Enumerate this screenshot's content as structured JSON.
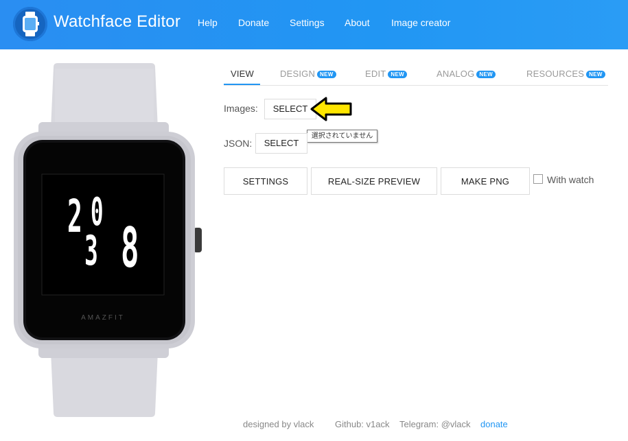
{
  "header": {
    "title": "Watchface Editor",
    "nav": [
      "Help",
      "Donate",
      "Settings",
      "About",
      "Image creator"
    ],
    "bg_color": "#2196f3"
  },
  "watch": {
    "brand": "AMAZFIT",
    "time_digits": [
      "2",
      "0",
      "3",
      "8"
    ],
    "band_color": "#dadae0",
    "screen_color": "#000000",
    "digit_color": "#ffffff"
  },
  "tabs": [
    {
      "label": "VIEW",
      "badge": ""
    },
    {
      "label": "DESIGN",
      "badge": "NEW"
    },
    {
      "label": "EDIT",
      "badge": "NEW"
    },
    {
      "label": "ANALOG",
      "badge": "NEW"
    },
    {
      "label": "RESOURCES",
      "badge": "NEW"
    }
  ],
  "view": {
    "images_label": "Images:",
    "images_button": "SELECT",
    "json_label": "JSON:",
    "json_button": "SELECT",
    "tooltip": "選択されていません",
    "settings_button": "SETTINGS",
    "preview_button": "REAL-SIZE PREVIEW",
    "png_button": "MAKE PNG",
    "with_watch_label": "With watch",
    "with_watch_checked": false
  },
  "footer": {
    "designed_by": "designed by vlack",
    "github": "Github: v1ack",
    "telegram": "Telegram: @vlack",
    "donate": "donate"
  },
  "accent_color": "#2196f3",
  "arrow_color": "#ffe600"
}
